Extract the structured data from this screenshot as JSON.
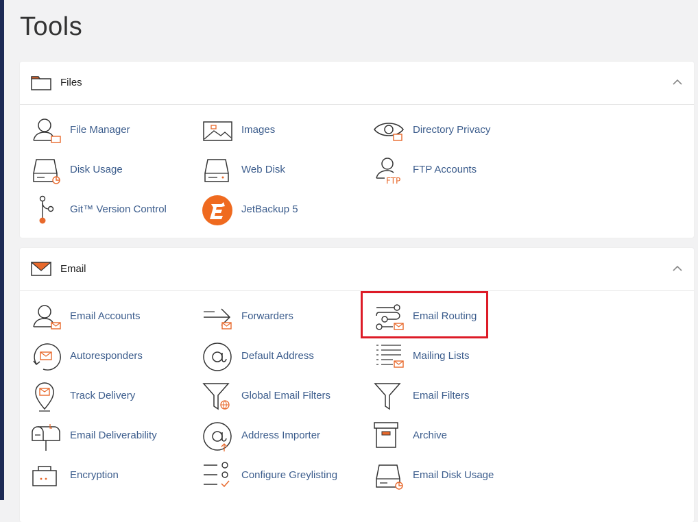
{
  "page": {
    "title": "Tools"
  },
  "sections": {
    "files": {
      "title": "Files",
      "items": [
        {
          "label": "File Manager",
          "icon": "file-manager-icon"
        },
        {
          "label": "Images",
          "icon": "images-icon"
        },
        {
          "label": "Directory Privacy",
          "icon": "directory-privacy-icon"
        },
        {
          "label": "Disk Usage",
          "icon": "disk-usage-icon"
        },
        {
          "label": "Web Disk",
          "icon": "web-disk-icon"
        },
        {
          "label": "FTP Accounts",
          "icon": "ftp-accounts-icon",
          "icon_text": "FTP"
        },
        {
          "label": "Git™ Version Control",
          "icon": "git-icon"
        },
        {
          "label": "JetBackup 5",
          "icon": "jetbackup-logo-icon"
        }
      ]
    },
    "email": {
      "title": "Email",
      "items": [
        {
          "label": "Email Accounts",
          "icon": "email-accounts-icon"
        },
        {
          "label": "Forwarders",
          "icon": "forwarders-icon"
        },
        {
          "label": "Email Routing",
          "icon": "email-routing-icon"
        },
        {
          "label": "Autoresponders",
          "icon": "autoresponders-icon"
        },
        {
          "label": "Default Address",
          "icon": "default-address-icon"
        },
        {
          "label": "Mailing Lists",
          "icon": "mailing-lists-icon"
        },
        {
          "label": "Track Delivery",
          "icon": "track-delivery-icon"
        },
        {
          "label": "Global Email Filters",
          "icon": "global-email-filters-icon"
        },
        {
          "label": "Email Filters",
          "icon": "email-filters-icon"
        },
        {
          "label": "Email Deliverability",
          "icon": "email-deliverability-icon"
        },
        {
          "label": "Address Importer",
          "icon": "address-importer-icon"
        },
        {
          "label": "Archive",
          "icon": "archive-icon"
        },
        {
          "label": "Encryption",
          "icon": "encryption-icon"
        },
        {
          "label": "Configure Greylisting",
          "icon": "configure-greylisting-icon"
        },
        {
          "label": "Email Disk Usage",
          "icon": "email-disk-usage-icon"
        }
      ]
    }
  },
  "colors": {
    "accent": "#e8692c",
    "link": "#3b5c8c",
    "highlight": "#dd1b27",
    "rail": "#1d2b55"
  }
}
